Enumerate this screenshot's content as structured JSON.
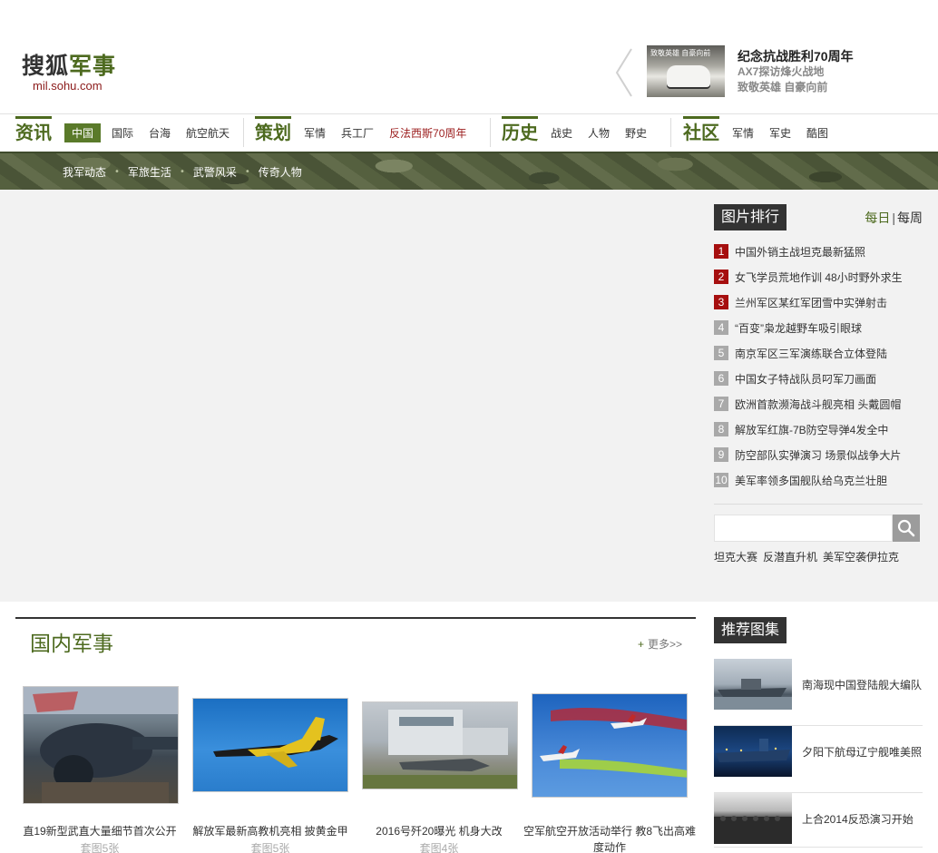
{
  "header": {
    "logo_cn_a": "搜狐",
    "logo_cn_b": "军事",
    "logo_en": "mil.sohu.com",
    "promo": {
      "thumb_caption": "致敬英雄 自豪向前",
      "title": "纪念抗战胜利70周年",
      "line1": "AX7探访烽火战地",
      "line2": "致敬英雄 自豪向前"
    }
  },
  "nav": {
    "groups": [
      {
        "head": "资讯",
        "items": [
          "中国",
          "国际",
          "台海",
          "航空航天"
        ]
      },
      {
        "head": "策划",
        "items": [
          "军情",
          "兵工厂",
          "反法西斯70周年"
        ]
      },
      {
        "head": "历史",
        "items": [
          "战史",
          "人物",
          "野史"
        ]
      },
      {
        "head": "社区",
        "items": [
          "军情",
          "军史",
          "酷图"
        ]
      }
    ]
  },
  "subnav": [
    "我军动态",
    "军旅生活",
    "武警风采",
    "传奇人物"
  ],
  "ranking": {
    "title": "图片排行",
    "tab_daily": "每日",
    "tab_sep": "|",
    "tab_weekly": "每周",
    "items": [
      {
        "num": "1",
        "text": "中国外销主战坦克最新猛照"
      },
      {
        "num": "2",
        "text": "女飞学员荒地作训 48小时野外求生"
      },
      {
        "num": "3",
        "text": "兰州军区某红军团雪中实弹射击"
      },
      {
        "num": "4",
        "text": "“百变”枭龙越野车吸引眼球"
      },
      {
        "num": "5",
        "text": "南京军区三军演练联合立体登陆"
      },
      {
        "num": "6",
        "text": "中国女子特战队员叼军刀画面"
      },
      {
        "num": "7",
        "text": "欧洲首款濒海战斗舰亮相 头戴圆帽"
      },
      {
        "num": "8",
        "text": "解放军红旗-7B防空导弹4发全中"
      },
      {
        "num": "9",
        "text": "防空部队实弹演习 场景似战争大片"
      },
      {
        "num": "10",
        "text": "美军率领多国舰队给乌克兰壮胆"
      }
    ]
  },
  "search": {
    "placeholder": ""
  },
  "hot_tags": [
    "坦克大赛",
    "反潜直升机",
    "美军空袭伊拉克"
  ],
  "domestic": {
    "title": "国内军事",
    "more": "更多>>",
    "more_plus": "+",
    "cards": [
      {
        "title": "直19新型武直大量细节首次公开",
        "sub": "套图5张"
      },
      {
        "title": "解放军最新高教机亮相 披黄金甲",
        "sub": "套图5张"
      },
      {
        "title": "2016号歼20曝光 机身大改",
        "sub": "套图4张"
      },
      {
        "title": "空军航空开放活动举行 教8飞出高难度动作",
        "sub": ""
      }
    ]
  },
  "recommend": {
    "title": "推荐图集",
    "items": [
      {
        "text": "南海现中国登陆舰大编队"
      },
      {
        "text": "夕阳下航母辽宁舰唯美照"
      },
      {
        "text": "上合2014反恐演习开始"
      }
    ]
  }
}
